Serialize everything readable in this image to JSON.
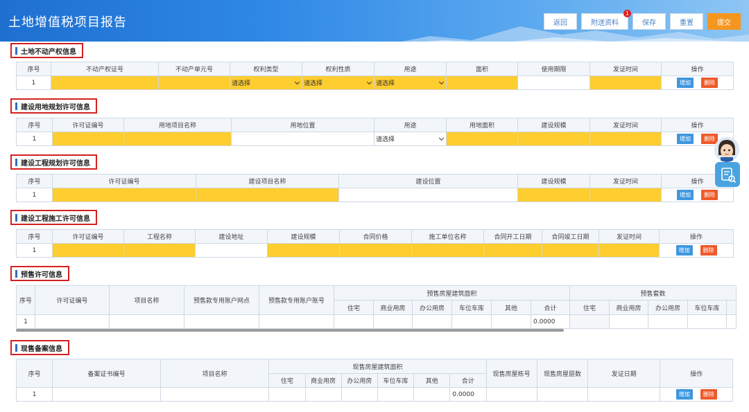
{
  "header": {
    "title": "土地增值税项目报告",
    "buttons": {
      "back": "返回",
      "attach": "附送资料",
      "save": "保存",
      "reset": "重置",
      "submit": "提交"
    },
    "attach_badge": "1"
  },
  "common": {
    "add": "增加",
    "delete": "删除",
    "select_placeholder": "请选择",
    "row_no": "1",
    "zero": "0.0000"
  },
  "sec1": {
    "title": "土地不动产权信息",
    "headers": [
      "序号",
      "不动产权证号",
      "不动产单元号",
      "权利类型",
      "权利性质",
      "用途",
      "面积",
      "使用期限",
      "发证时间",
      "操作"
    ]
  },
  "sec2": {
    "title": "建设用地规划许可信息",
    "headers": [
      "序号",
      "许可证编号",
      "用地项目名称",
      "用地位置",
      "用途",
      "用地面积",
      "建设规模",
      "发证时间",
      "操作"
    ]
  },
  "sec3": {
    "title": "建设工程规划许可信息",
    "headers": [
      "序号",
      "许可证编号",
      "建设项目名称",
      "建设位置",
      "建设规模",
      "发证时间",
      "操作"
    ]
  },
  "sec4": {
    "title": "建设工程施工许可信息",
    "headers": [
      "序号",
      "许可证编号",
      "工程名称",
      "建设地址",
      "建设规模",
      "合同价格",
      "施工单位名称",
      "合同开工日期",
      "合同竣工日期",
      "发证时间",
      "操作"
    ]
  },
  "sec5": {
    "title": "预售许可信息",
    "headers": [
      "序号",
      "许可证编号",
      "项目名称",
      "预售款专用账户网点",
      "预售款专用账户账号"
    ],
    "group_area": "预售房屋建筑面积",
    "group_units": "预售套数",
    "area_sub": [
      "住宅",
      "商业用房",
      "办公用房",
      "车位车库",
      "其他",
      "合计"
    ],
    "units_sub": [
      "住宅",
      "商业用房",
      "办公用房",
      "车位车库"
    ]
  },
  "sec6": {
    "title": "现售备案信息",
    "headers": [
      "序号",
      "备案证书编号",
      "项目名称"
    ],
    "group_area": "现售房屋建筑面积",
    "area_sub": [
      "住宅",
      "商业用房",
      "办公用房",
      "车位车库",
      "其他",
      "合计"
    ],
    "tail_headers": [
      "现售房屋栋号",
      "现售房屋层数",
      "发证日期",
      "操作"
    ]
  },
  "colors": {
    "header_blue": "#2f88e6",
    "highlight_yellow": "#fecd2f",
    "add_blue": "#3f97de",
    "delete_orange": "#ee5a2a",
    "submit_orange": "#f5961f",
    "section_border_red": "#d42020"
  }
}
